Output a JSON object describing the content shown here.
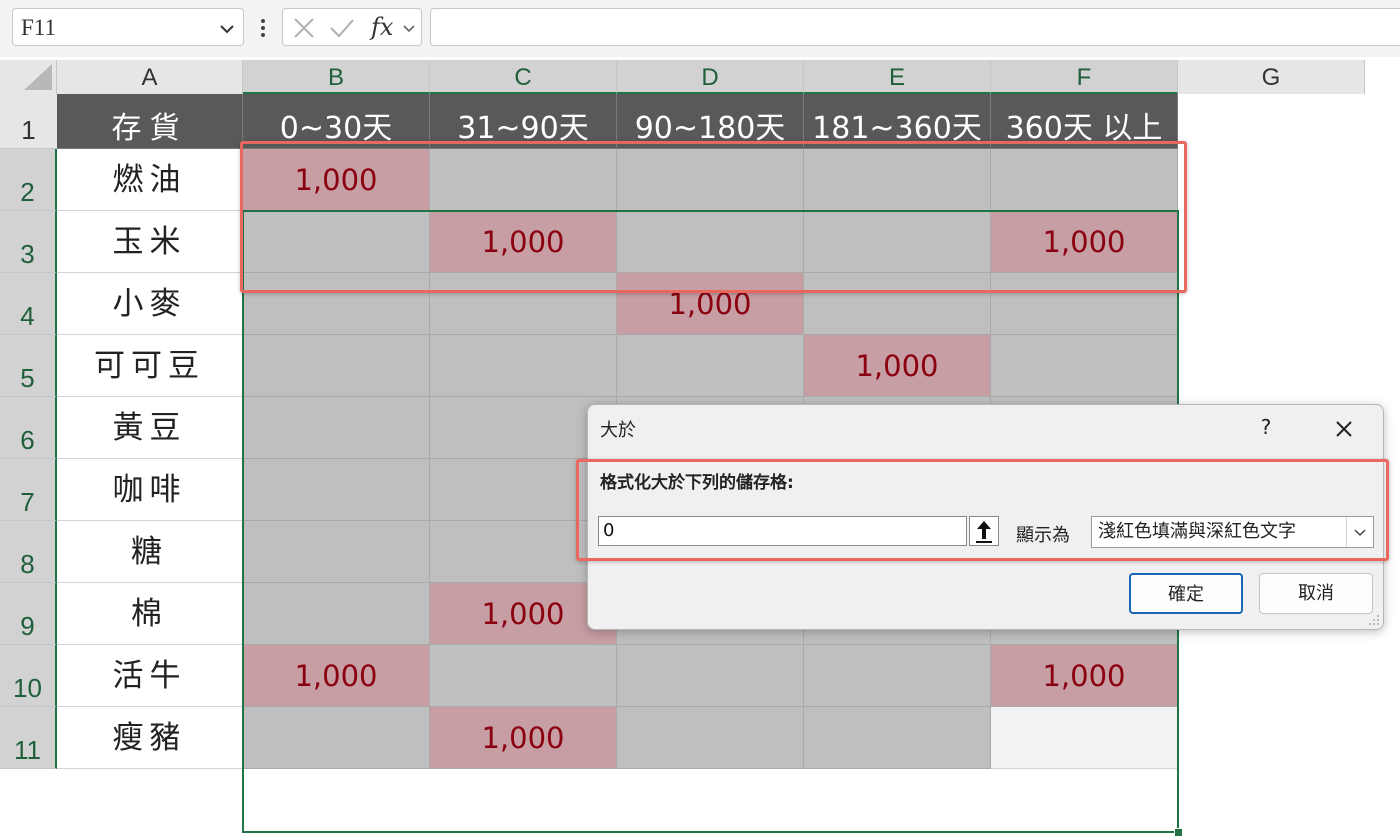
{
  "formula_bar": {
    "name_box": "F11",
    "fx_label": "fx",
    "formula_value": ""
  },
  "columns": [
    "A",
    "B",
    "C",
    "D",
    "E",
    "F",
    "G"
  ],
  "rows": [
    "1",
    "2",
    "3",
    "4",
    "5",
    "6",
    "7",
    "8",
    "9",
    "10",
    "11"
  ],
  "table": {
    "headers": [
      "存貨",
      "0~30天",
      "31~90天",
      "90~180天",
      "181~360天",
      "360天 以上"
    ],
    "items": [
      "燃油",
      "玉米",
      "小麥",
      "可可豆",
      "黃豆",
      "咖啡",
      "糖",
      "棉",
      "活牛",
      "瘦豬"
    ],
    "values": [
      [
        "1,000",
        "",
        "",
        "",
        ""
      ],
      [
        "",
        "1,000",
        "",
        "",
        "1,000"
      ],
      [
        "",
        "",
        "1,000",
        "",
        ""
      ],
      [
        "",
        "",
        "",
        "1,000",
        ""
      ],
      [
        "",
        "",
        "",
        "",
        ""
      ],
      [
        "",
        "",
        "",
        "",
        ""
      ],
      [
        "",
        "",
        "",
        "",
        ""
      ],
      [
        "",
        "1,000",
        "",
        "",
        ""
      ],
      [
        "1,000",
        "",
        "",
        "",
        "1,000"
      ],
      [
        "",
        "1,000",
        "",
        "",
        ""
      ]
    ]
  },
  "dialog": {
    "title": "大於",
    "help": "?",
    "prompt": "格式化大於下列的儲存格:",
    "value": "0",
    "show_as_label": "顯示為",
    "format_option": "淺紅色填滿與深紅色文字",
    "ok_label": "確定",
    "cancel_label": "取消"
  },
  "colors": {
    "header_fill": "#595959",
    "highlight_fill": "#c79ea4",
    "highlight_text": "#8b0010",
    "empty_fill": "#bfbfbf",
    "selection_border": "#217346",
    "callout_border": "#e8675f"
  }
}
